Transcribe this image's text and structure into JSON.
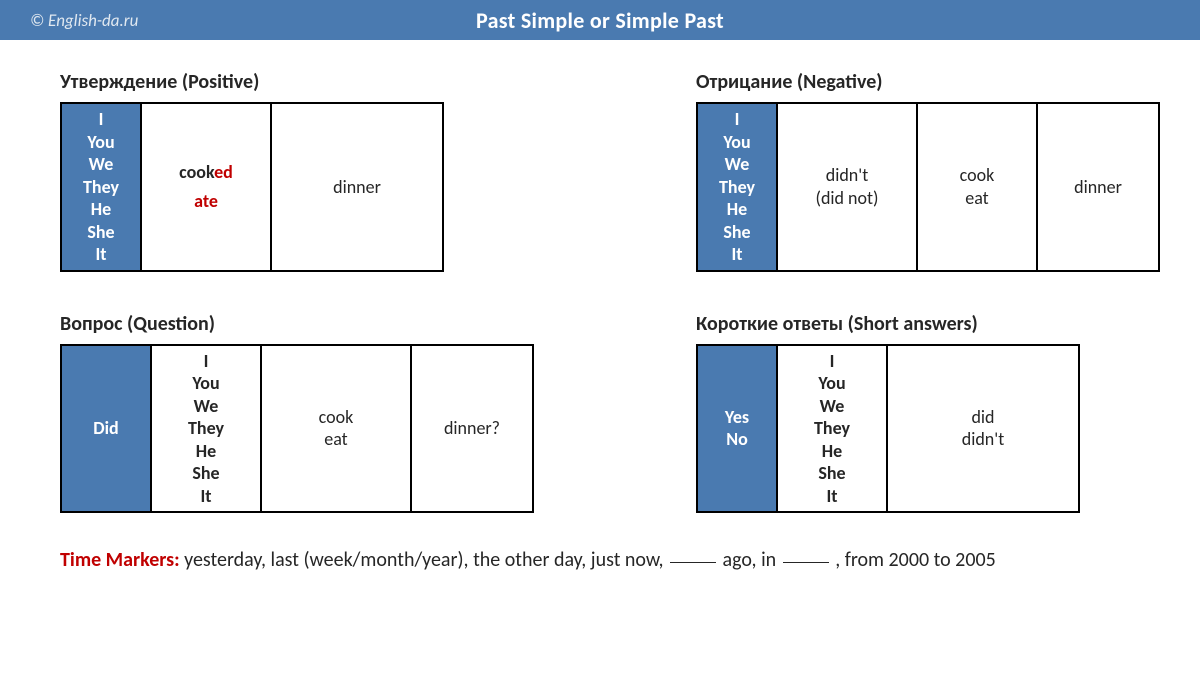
{
  "header": {
    "site": "© English-da.ru",
    "title": "Past Simple or Simple Past"
  },
  "pronouns": {
    "i": "I",
    "you": "You",
    "we": "We",
    "they": "They",
    "he": "He",
    "she": "She",
    "it": "It"
  },
  "positive": {
    "title": "Утверждение (Positive)",
    "verb1_base": "cook",
    "verb1_suffix": "ed",
    "verb2": "ate",
    "obj": "dinner"
  },
  "negative": {
    "title": "Отрицание (Negative)",
    "aux1": "didn't",
    "aux2": "(did not)",
    "verb1": "cook",
    "verb2": "eat",
    "obj": "dinner"
  },
  "question": {
    "title": "Вопрос (Question)",
    "aux": "Did",
    "verb1": "cook",
    "verb2": "eat",
    "obj": "dinner?"
  },
  "short": {
    "title": "Короткие ответы (Short answers)",
    "yes": "Yes",
    "no": "No",
    "did": "did",
    "didnt": "didn't"
  },
  "time": {
    "label": "Time Markers:",
    "p1": "yesterday, last (week/month/year), the other day, just now,",
    "p2": "ago,  in",
    "p3": ", from 2000 to 2005"
  }
}
